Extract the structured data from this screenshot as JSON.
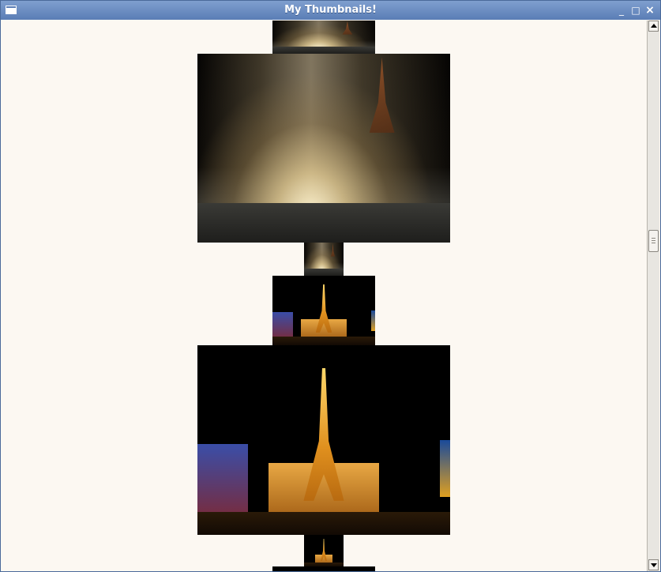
{
  "window": {
    "title": "My Thumbnails!"
  },
  "thumbnails": [
    {
      "subject": "fountain",
      "size": "medium",
      "visible": "partial-top"
    },
    {
      "subject": "fountain",
      "size": "large"
    },
    {
      "subject": "fountain",
      "size": "small"
    },
    {
      "subject": "eiffel-tower",
      "size": "medium"
    },
    {
      "subject": "eiffel-tower",
      "size": "large"
    },
    {
      "subject": "eiffel-tower",
      "size": "small",
      "visible": "partial-bottom"
    }
  ],
  "icons": {
    "window_menu": "window-menu-icon",
    "minimize": "minimize-icon",
    "maximize": "maximize-icon",
    "close": "close-icon",
    "scroll_up": "scroll-up-arrow-icon",
    "scroll_down": "scroll-down-arrow-icon"
  },
  "colors": {
    "titlebar": "#6a8cc2",
    "background": "#fcf8f2",
    "scroll_track": "#e8e6e1"
  }
}
